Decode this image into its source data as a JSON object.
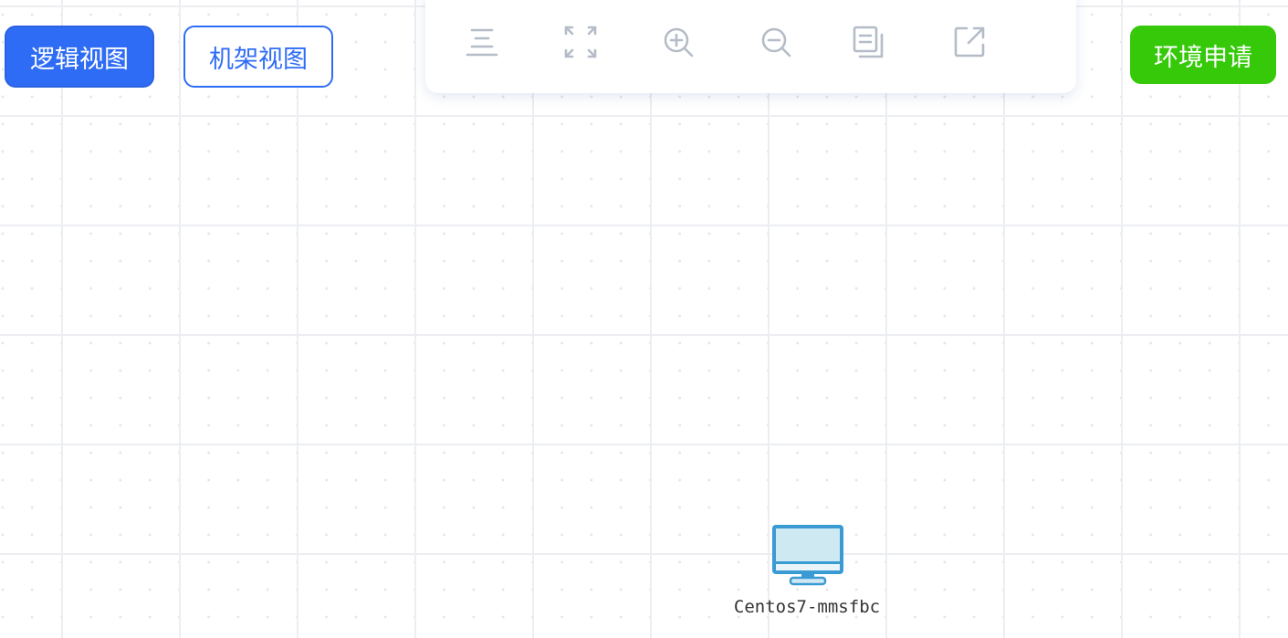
{
  "views": {
    "logic_label": "逻辑视图",
    "rack_label": "机架视图"
  },
  "actions": {
    "apply_label": "环境申请"
  },
  "toolbar": {
    "tools": [
      {
        "icon": "align-center-icon"
      },
      {
        "icon": "fit-screen-icon"
      },
      {
        "icon": "zoom-in-icon"
      },
      {
        "icon": "zoom-out-icon"
      },
      {
        "icon": "copy-icon"
      },
      {
        "icon": "export-icon"
      }
    ]
  },
  "nodes": [
    {
      "label": "Centos7-mmsfbc",
      "icon": "computer-monitor-icon"
    }
  ],
  "colors": {
    "primary": "#2f6cf6",
    "success": "#35c90a",
    "icon_gray": "#b4bcc7",
    "monitor_stroke": "#3a9ad4",
    "monitor_screen": "#cfe9f3"
  }
}
